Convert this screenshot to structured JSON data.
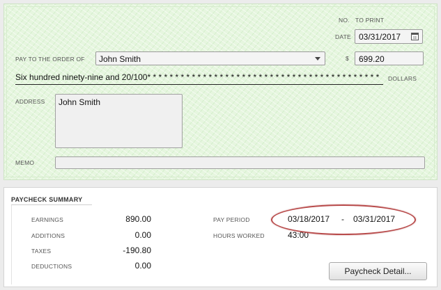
{
  "check": {
    "no_label": "NO.",
    "no_value": "TO PRINT",
    "date_label": "DATE",
    "date_value": "03/31/2017",
    "pay_to_label": "PAY TO THE ORDER OF",
    "payee": "John Smith",
    "currency_label": "$",
    "amount": "699.20",
    "amount_words": "Six hundred ninety-nine and 20/100* * * * * * * * * * * * * * * * * * * * * * * * * * * * * * * * * * * * * * * * * *",
    "dollars_label": "DOLLARS",
    "address_label": "ADDRESS",
    "address_value": "John Smith",
    "memo_label": "MEMO",
    "memo_value": ""
  },
  "summary": {
    "title": "PAYCHECK SUMMARY",
    "earnings_label": "EARNINGS",
    "earnings_value": "890.00",
    "additions_label": "ADDITIONS",
    "additions_value": "0.00",
    "taxes_label": "TAXES",
    "taxes_value": "-190.80",
    "deductions_label": "DEDUCTIONS",
    "deductions_value": "0.00",
    "pay_period_label": "PAY PERIOD",
    "pay_period_start": "03/18/2017",
    "pay_period_sep": "-",
    "pay_period_end": "03/31/2017",
    "hours_label": "HOURS WORKED",
    "hours_value": "43:00",
    "detail_button": "Paycheck Detail..."
  },
  "colors": {
    "check_bg": "#e6f6df",
    "highlight": "#b84a4a"
  },
  "icons": {
    "date_picker": "calendar-icon",
    "payee_dropdown": "chevron-down-icon"
  }
}
